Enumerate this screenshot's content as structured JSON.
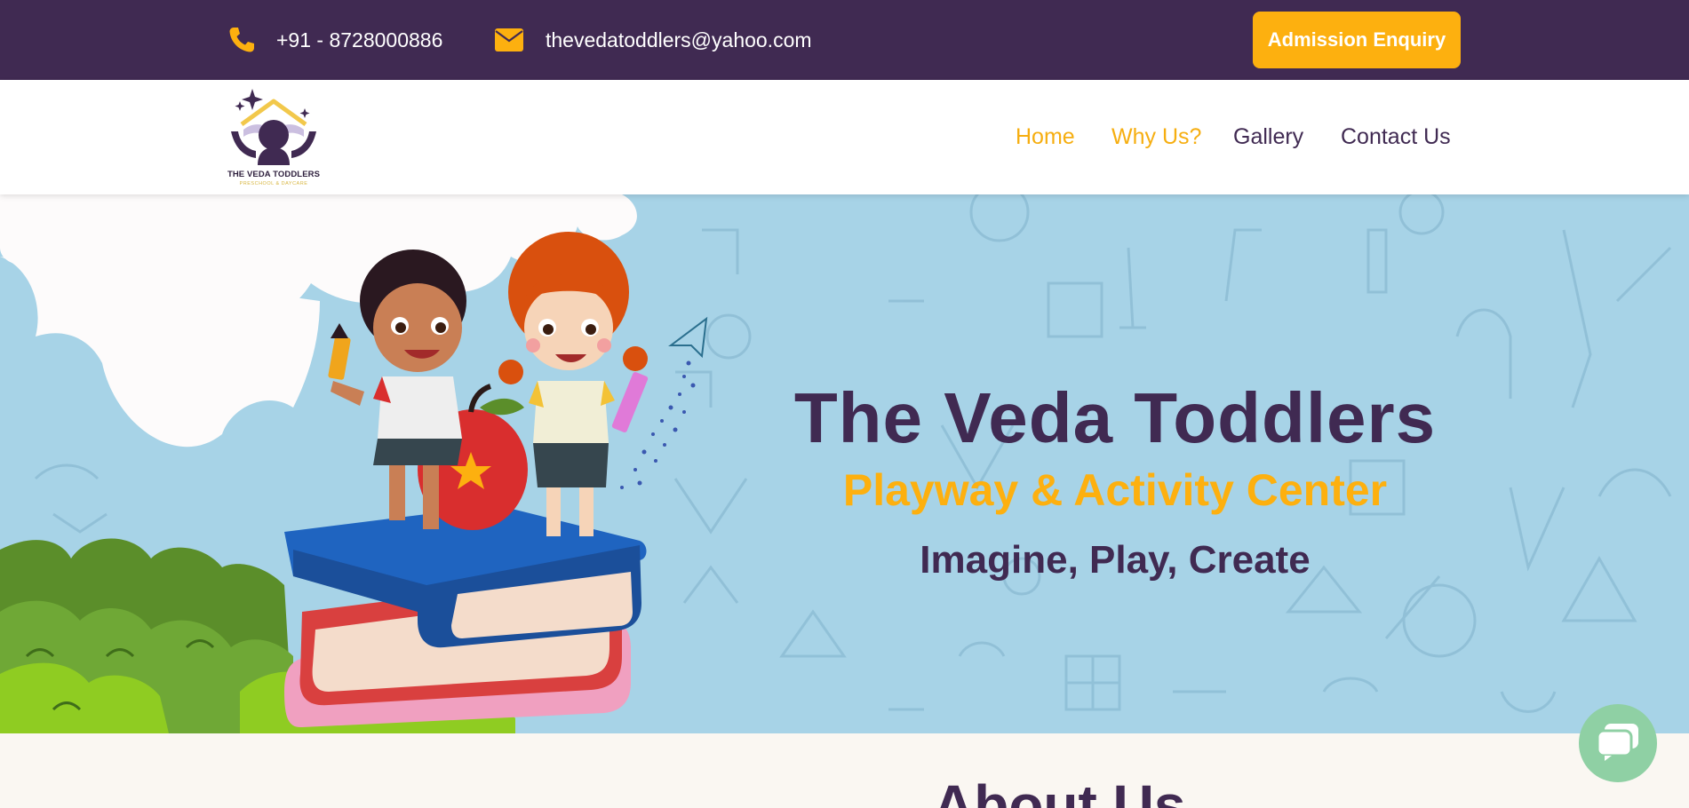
{
  "topbar": {
    "phone": "+91 - 8728000886",
    "email": "thevedatoddlers@yahoo.com",
    "enquiry_label": "Admission Enquiry"
  },
  "logo": {
    "name": "THE VEDA TODDLERS",
    "tagline": "PRESCHOOL & DAYCARE"
  },
  "nav": [
    {
      "label": "Home",
      "active": true
    },
    {
      "label": "Why Us?",
      "active": false
    },
    {
      "label": "Gallery",
      "active": false
    },
    {
      "label": "Contact Us",
      "active": false
    }
  ],
  "hero": {
    "title": "The Veda Toddlers",
    "subtitle": "Playway & Activity Center",
    "tagline": "Imagine, Play, Create"
  },
  "about": {
    "title": "About Us"
  },
  "colors": {
    "brand_purple": "#402a52",
    "accent_yellow": "#fdb00f",
    "hero_blue": "#a7d3e7",
    "chat_green": "#8fd0a4"
  },
  "icons": [
    "phone-icon",
    "envelope-icon",
    "chat-icon"
  ]
}
